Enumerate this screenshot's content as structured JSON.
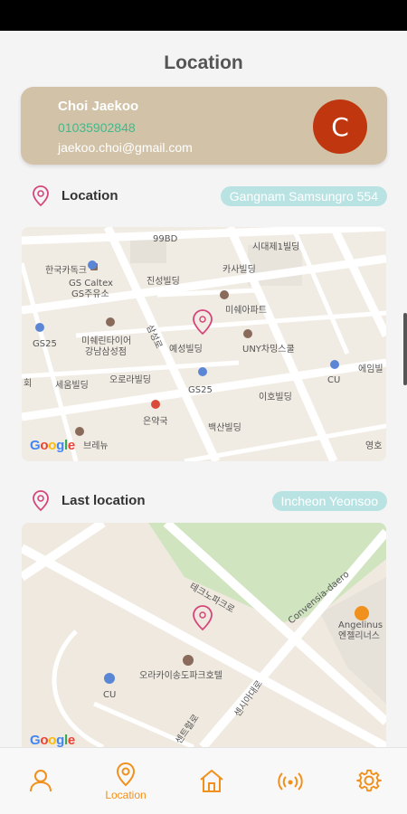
{
  "header": {
    "title": "Location"
  },
  "profile": {
    "name": "Choi Jaekoo",
    "phone": "01035902848",
    "email": "jaekoo.choi@gmail.com",
    "avatar_letter": "C"
  },
  "current_location": {
    "label": "Location",
    "address": "Gangnam Samsungro 554"
  },
  "last_location": {
    "label": "Last location",
    "address": "Incheon Yeonsoo"
  },
  "map1": {
    "labels": [
      "한국카독크",
      "99BD",
      "시대제1빌딩",
      "카사빌딩",
      "GS Caltex",
      "GS주유소",
      "진성빌딩",
      "삼성로",
      "미쉐아파트",
      "GS25",
      "미쉐린타이어",
      "강남삼성점",
      "예성빌딩",
      "UNY차밍스쿨",
      "오로라빌딩",
      "세움빌딩",
      "GS25",
      "CU",
      "에임빌",
      "이호빌딩",
      "은약국",
      "백산빌딩",
      "브레뉴",
      "영호",
      "회"
    ]
  },
  "map2": {
    "labels": [
      "테크노파크로",
      "Convensia-daero",
      "Angelinus",
      "엔젤리너스",
      "오라카이송도파크호텔",
      "CU",
      "센트럴로",
      "센시아대로"
    ]
  },
  "google_logo": [
    "G",
    "o",
    "o",
    "g",
    "l",
    "e"
  ],
  "nav": {
    "items": [
      {
        "icon": "person-icon",
        "label": ""
      },
      {
        "icon": "location-pin-icon",
        "label": "Location"
      },
      {
        "icon": "home-icon",
        "label": ""
      },
      {
        "icon": "broadcast-icon",
        "label": ""
      },
      {
        "icon": "gear-icon",
        "label": ""
      }
    ]
  },
  "colors": {
    "accent": "#f0901d",
    "card": "#d2c3a8",
    "pill": "#b9e3e3",
    "avatar": "#c0360f",
    "phone": "#3fb98c",
    "pin": "#d6457a"
  }
}
